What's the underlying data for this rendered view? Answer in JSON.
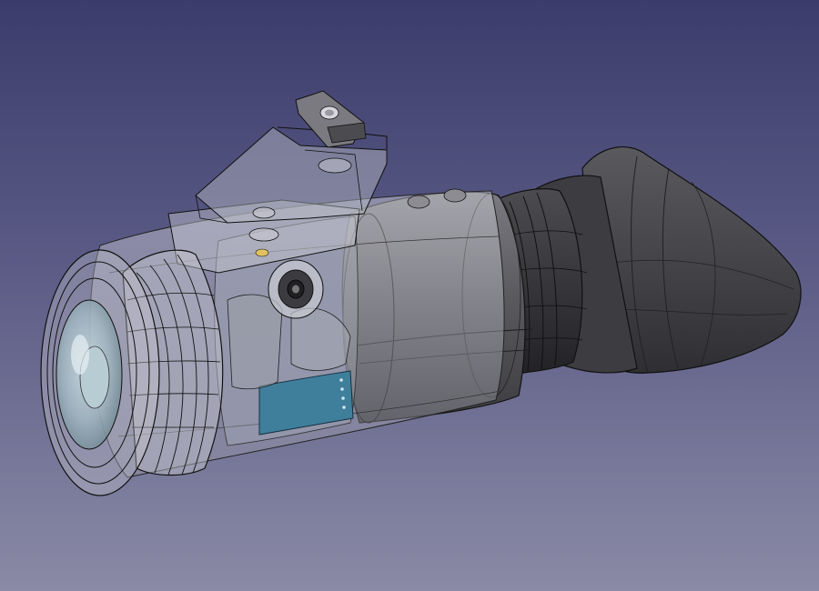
{
  "viewport": {
    "background_top": "#3c3c6c",
    "background_bottom": "#8a8aa6"
  },
  "model": {
    "parts": [
      "objective-lens-assembly",
      "focus-ring",
      "transparent-housing",
      "top-mount-bracket",
      "mounting-screw",
      "adjustment-knob",
      "blue-circuit-board",
      "main-body-tube",
      "diopter-ring",
      "rubber-eyecup"
    ],
    "colors": {
      "body": "#5e5e62",
      "body_dark": "#3a3a3e",
      "eyecup": "#4a4a4e",
      "circuit_board": "#3f7f9c",
      "edge_lines": "#111111",
      "transparent_shell": "#c8c8d0"
    }
  }
}
